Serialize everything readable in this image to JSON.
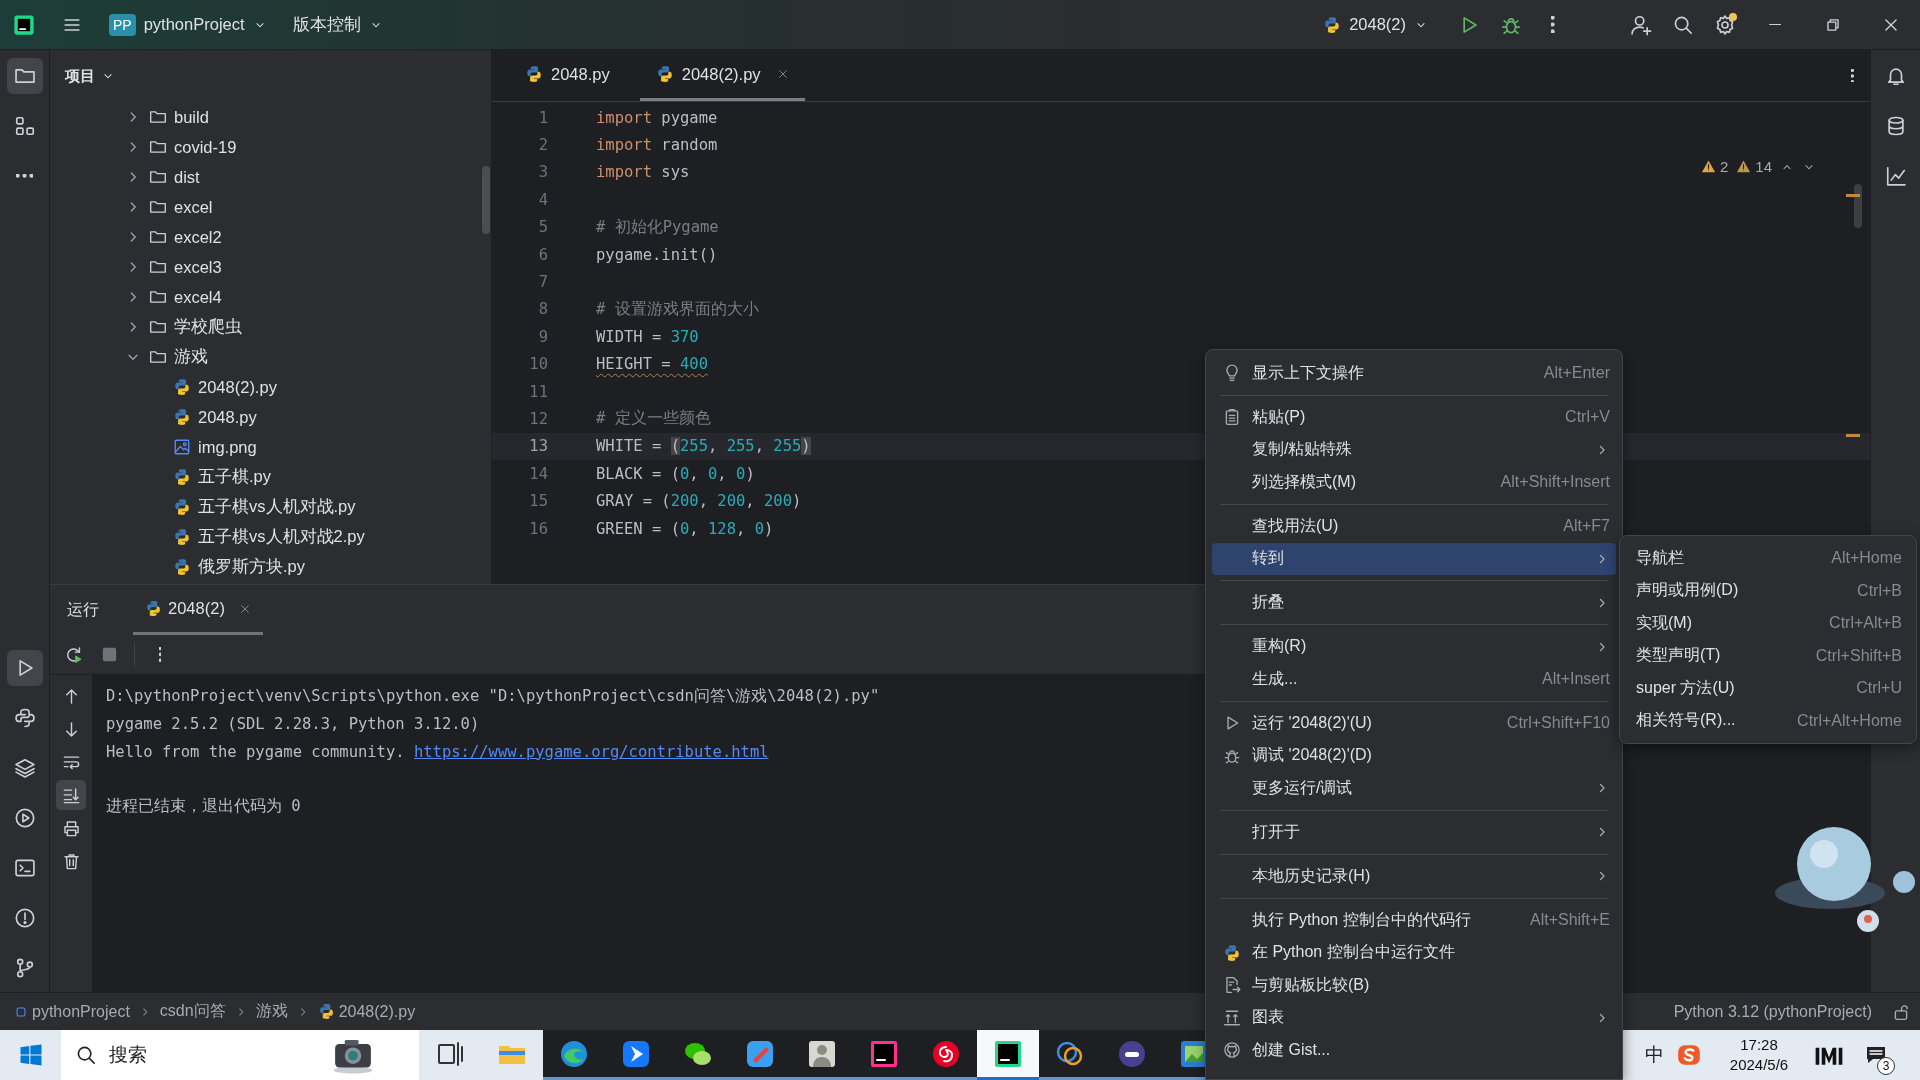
{
  "title_bar": {
    "project_badge": "PP",
    "project": "pythonProject",
    "vcs": "版本控制",
    "run_config": "2048(2)"
  },
  "tool_strip": {
    "top": [
      {
        "selected": true
      },
      {
        "selected": false
      }
    ],
    "bottom": [
      {
        "selected": true
      },
      {
        "selected": false
      },
      {
        "selected": false
      },
      {
        "selected": false
      },
      {
        "selected": false
      },
      {
        "selected": false
      },
      {
        "selected": false
      }
    ]
  },
  "project_panel": {
    "title": "项目",
    "tree": [
      {
        "kind": "folder",
        "name": "build",
        "expanded": false
      },
      {
        "kind": "folder",
        "name": "covid-19",
        "expanded": false
      },
      {
        "kind": "folder",
        "name": "dist",
        "expanded": false
      },
      {
        "kind": "folder",
        "name": "excel",
        "expanded": false
      },
      {
        "kind": "folder",
        "name": "excel2",
        "expanded": false
      },
      {
        "kind": "folder",
        "name": "excel3",
        "expanded": false
      },
      {
        "kind": "folder",
        "name": "excel4",
        "expanded": false
      },
      {
        "kind": "folder",
        "name": "学校爬虫",
        "expanded": false
      },
      {
        "kind": "folder",
        "name": "游戏",
        "expanded": true,
        "children": [
          {
            "kind": "python",
            "name": "2048(2).py"
          },
          {
            "kind": "python",
            "name": "2048.py"
          },
          {
            "kind": "image",
            "name": "img.png"
          },
          {
            "kind": "python",
            "name": "五子棋.py"
          },
          {
            "kind": "python",
            "name": "五子棋vs人机对战.py"
          },
          {
            "kind": "python",
            "name": "五子棋vs人机对战2.py"
          },
          {
            "kind": "python",
            "name": "俄罗斯方块.py"
          }
        ]
      }
    ]
  },
  "editor": {
    "tabs": [
      {
        "label": "2048.py",
        "selected": false
      },
      {
        "label": "2048(2).py",
        "selected": true
      }
    ],
    "inspections": [
      {
        "kind": "warning",
        "count": "2"
      },
      {
        "kind": "weak_warning",
        "count": "14"
      }
    ],
    "lines": [
      {
        "number": "1",
        "current": false,
        "tokens": [
          {
            "kind": "keyword",
            "text": "import"
          },
          {
            "kind": "plain",
            "text": " pygame"
          }
        ]
      },
      {
        "number": "2",
        "current": false,
        "tokens": [
          {
            "kind": "keyword",
            "text": "import"
          },
          {
            "kind": "plain",
            "text": " random"
          }
        ]
      },
      {
        "number": "3",
        "current": false,
        "tokens": [
          {
            "kind": "keyword",
            "text": "import"
          },
          {
            "kind": "plain",
            "text": " sys"
          }
        ]
      },
      {
        "number": "4",
        "current": false
      },
      {
        "number": "5",
        "current": false,
        "tokens": [
          {
            "kind": "comment",
            "text": "# 初始化Pygame"
          }
        ]
      },
      {
        "number": "6",
        "current": false,
        "tokens": [
          {
            "kind": "plain",
            "text": "pygame.init()"
          }
        ]
      },
      {
        "number": "7",
        "current": false
      },
      {
        "number": "8",
        "current": false,
        "tokens": [
          {
            "kind": "comment",
            "text": "# 设置游戏界面的大小"
          }
        ]
      },
      {
        "number": "9",
        "current": false,
        "tokens": [
          {
            "kind": "plain",
            "text": "WIDTH = "
          },
          {
            "kind": "number",
            "text": "370"
          }
        ]
      },
      {
        "number": "10",
        "current": false,
        "tokens": [
          {
            "kind": "plain",
            "text": "HEIGHT = ",
            "underlined": true
          },
          {
            "kind": "number",
            "text": "400",
            "underlined": true
          }
        ]
      },
      {
        "number": "11",
        "current": false
      },
      {
        "number": "12",
        "current": false,
        "tokens": [
          {
            "kind": "comment",
            "text": "# 定义一些颜色"
          }
        ]
      },
      {
        "number": "13",
        "current": true,
        "tokens": [
          {
            "kind": "plain",
            "text": "WHITE = "
          },
          {
            "kind": "plain",
            "text": "(",
            "matched": true
          },
          {
            "kind": "number",
            "text": "255"
          },
          {
            "kind": "plain",
            "text": ", "
          },
          {
            "kind": "number",
            "text": "255"
          },
          {
            "kind": "plain",
            "text": ", "
          },
          {
            "kind": "number",
            "text": "255"
          },
          {
            "kind": "plain",
            "text": ")",
            "matched": true
          }
        ]
      },
      {
        "number": "14",
        "current": false,
        "tokens": [
          {
            "kind": "plain",
            "text": "BLACK = ("
          },
          {
            "kind": "number",
            "text": "0"
          },
          {
            "kind": "plain",
            "text": ", "
          },
          {
            "kind": "number",
            "text": "0"
          },
          {
            "kind": "plain",
            "text": ", "
          },
          {
            "kind": "number",
            "text": "0"
          },
          {
            "kind": "plain",
            "text": ")"
          }
        ]
      },
      {
        "number": "15",
        "current": false,
        "tokens": [
          {
            "kind": "plain",
            "text": "GRAY = ("
          },
          {
            "kind": "number",
            "text": "200"
          },
          {
            "kind": "plain",
            "text": ", "
          },
          {
            "kind": "number",
            "text": "200"
          },
          {
            "kind": "plain",
            "text": ", "
          },
          {
            "kind": "number",
            "text": "200"
          },
          {
            "kind": "plain",
            "text": ")"
          }
        ]
      },
      {
        "number": "16",
        "current": false,
        "tokens": [
          {
            "kind": "plain",
            "text": "GREEN = ("
          },
          {
            "kind": "number",
            "text": "0"
          },
          {
            "kind": "plain",
            "text": ", "
          },
          {
            "kind": "number",
            "text": "128"
          },
          {
            "kind": "plain",
            "text": ", "
          },
          {
            "kind": "number",
            "text": "0"
          },
          {
            "kind": "plain",
            "text": ")"
          }
        ]
      }
    ]
  },
  "run_panel": {
    "title": "运行",
    "tabs": [
      {
        "label": "2048(2)",
        "selected": true
      }
    ],
    "tools": [
      {
        "selected": false
      },
      {
        "selected": false
      },
      {
        "selected": false
      },
      {
        "selected": true
      },
      {
        "selected": false
      },
      {
        "selected": false
      }
    ],
    "output": [
      {
        "blank_before": false,
        "segments": [
          {
            "kind": "text",
            "text": "D:\\pythonProject\\venv\\Scripts\\python.exe \"D:\\pythonProject\\csdn问答\\游戏\\2048(2).py\""
          }
        ]
      },
      {
        "blank_before": false,
        "segments": [
          {
            "kind": "text",
            "text": "pygame 2.5.2 (SDL 2.28.3, Python 3.12.0)"
          }
        ]
      },
      {
        "blank_before": false,
        "segments": [
          {
            "kind": "text",
            "text": "Hello from the pygame community. "
          },
          {
            "kind": "link",
            "text": "https://www.pygame.org/contribute.html"
          }
        ]
      },
      {
        "blank_before": true,
        "segments": [
          {
            "kind": "text",
            "text": "进程已结束，退出代码为 0"
          }
        ]
      }
    ]
  },
  "context_menu": {
    "groups": [
      [
        {
          "label": "显示上下文操作",
          "shortcut": "Alt+Enter",
          "submenu": false,
          "selected": false
        }
      ],
      [
        {
          "label": "粘贴(P)",
          "shortcut": "Ctrl+V",
          "submenu": false,
          "selected": false
        },
        {
          "label": "复制/粘贴特殊",
          "submenu": true,
          "selected": false
        },
        {
          "label": "列选择模式(M)",
          "shortcut": "Alt+Shift+Insert",
          "submenu": false,
          "selected": false
        }
      ],
      [
        {
          "label": "查找用法(U)",
          "shortcut": "Alt+F7",
          "submenu": false,
          "selected": false
        },
        {
          "label": "转到",
          "submenu": true,
          "selected": true
        }
      ],
      [
        {
          "label": "折叠",
          "submenu": true,
          "selected": false
        }
      ],
      [
        {
          "label": "重构(R)",
          "submenu": true,
          "selected": false
        },
        {
          "label": "生成...",
          "shortcut": "Alt+Insert",
          "submenu": false,
          "selected": false
        }
      ],
      [
        {
          "label": "运行 '2048(2)'(U)",
          "shortcut": "Ctrl+Shift+F10",
          "submenu": false,
          "selected": false
        },
        {
          "label": "调试 '2048(2)'(D)",
          "submenu": false,
          "selected": false
        },
        {
          "label": "更多运行/调试",
          "submenu": true,
          "selected": false
        }
      ],
      [
        {
          "label": "打开于",
          "submenu": true,
          "selected": false
        }
      ],
      [
        {
          "label": "本地历史记录(H)",
          "submenu": true,
          "selected": false
        }
      ],
      [
        {
          "label": "执行 Python 控制台中的代码行",
          "shortcut": "Alt+Shift+E",
          "submenu": false,
          "selected": false
        },
        {
          "label": "在 Python 控制台中运行文件",
          "submenu": false,
          "selected": false
        },
        {
          "label": "与剪贴板比较(B)",
          "submenu": false,
          "selected": false
        },
        {
          "label": "图表",
          "submenu": true,
          "selected": false
        },
        {
          "label": "创建 Gist...",
          "submenu": false,
          "selected": false
        }
      ]
    ],
    "goto_submenu": [
      {
        "label": "导航栏",
        "shortcut": "Alt+Home"
      },
      {
        "label": "声明或用例(D)",
        "shortcut": "Ctrl+B"
      },
      {
        "label": "实现(M)",
        "shortcut": "Ctrl+Alt+B"
      },
      {
        "label": "类型声明(T)",
        "shortcut": "Ctrl+Shift+B"
      },
      {
        "label": "super 方法(U)",
        "shortcut": "Ctrl+U"
      },
      {
        "label": "相关符号(R)...",
        "shortcut": "Ctrl+Alt+Home"
      }
    ]
  },
  "status_bar": {
    "breadcrumbs": [
      {
        "kind": "project",
        "label": "pythonProject"
      },
      {
        "kind": "folder",
        "label": "csdn问答"
      },
      {
        "kind": "folder",
        "label": "游戏"
      },
      {
        "kind": "python",
        "label": "2048(2).py"
      }
    ],
    "interpreter": "Python 3.12 (pythonProject)"
  },
  "taskbar": {
    "search": {
      "placeholder": "搜索"
    },
    "apps": [
      {
        "running": false,
        "active": false
      },
      {
        "running": false,
        "active": false
      },
      {
        "running": true,
        "active": false
      },
      {
        "running": true,
        "active": false
      },
      {
        "running": true,
        "active": false
      },
      {
        "running": true,
        "active": false
      },
      {
        "running": true,
        "active": false
      },
      {
        "running": true,
        "active": false
      },
      {
        "running": true,
        "active": false
      },
      {
        "running": true,
        "active": true
      },
      {
        "running": true,
        "active": false
      },
      {
        "running": true,
        "active": false
      },
      {
        "running": true,
        "active": false
      }
    ],
    "ime": "中",
    "time": "17:28",
    "date": "2024/5/6",
    "notifications": "3"
  }
}
